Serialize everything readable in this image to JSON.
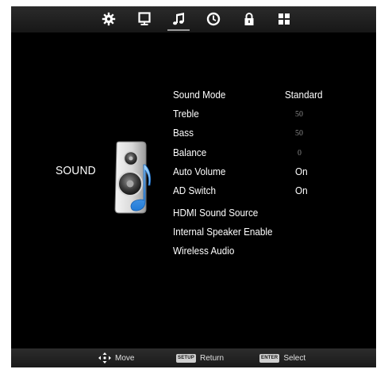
{
  "tabs": [
    {
      "icon": "picture-settings-icon",
      "active": false
    },
    {
      "icon": "monitor-icon",
      "active": false
    },
    {
      "icon": "music-note-icon",
      "active": true
    },
    {
      "icon": "clock-icon",
      "active": false
    },
    {
      "icon": "lock-icon",
      "active": false
    },
    {
      "icon": "grid-icon",
      "active": false
    }
  ],
  "page": {
    "title": "SOUND",
    "icon": "speaker-music-icon"
  },
  "menu": {
    "sound_mode": {
      "label": "Sound Mode",
      "value": "Standard"
    },
    "treble": {
      "label": "Treble",
      "value": "50"
    },
    "bass": {
      "label": "Bass",
      "value": "50"
    },
    "balance": {
      "label": "Balance",
      "value": "0"
    },
    "auto_volume": {
      "label": "Auto Volume",
      "value": "On"
    },
    "ad_switch": {
      "label": "AD Switch",
      "value": "On"
    },
    "hdmi_sound_source": {
      "label": "HDMI Sound Source"
    },
    "internal_speaker_enable": {
      "label": "Internal Speaker Enable"
    },
    "wireless_audio": {
      "label": "Wireless Audio"
    }
  },
  "hints": {
    "move": {
      "label": "Move",
      "icon": "move-arrows-icon"
    },
    "return": {
      "key": "SETUP",
      "label": "Return"
    },
    "select": {
      "key": "ENTER",
      "label": "Select"
    }
  },
  "colors": {
    "background": "#000000",
    "bar": "#222222",
    "text": "#ffffff",
    "dim_value": "#8a8a8a"
  }
}
